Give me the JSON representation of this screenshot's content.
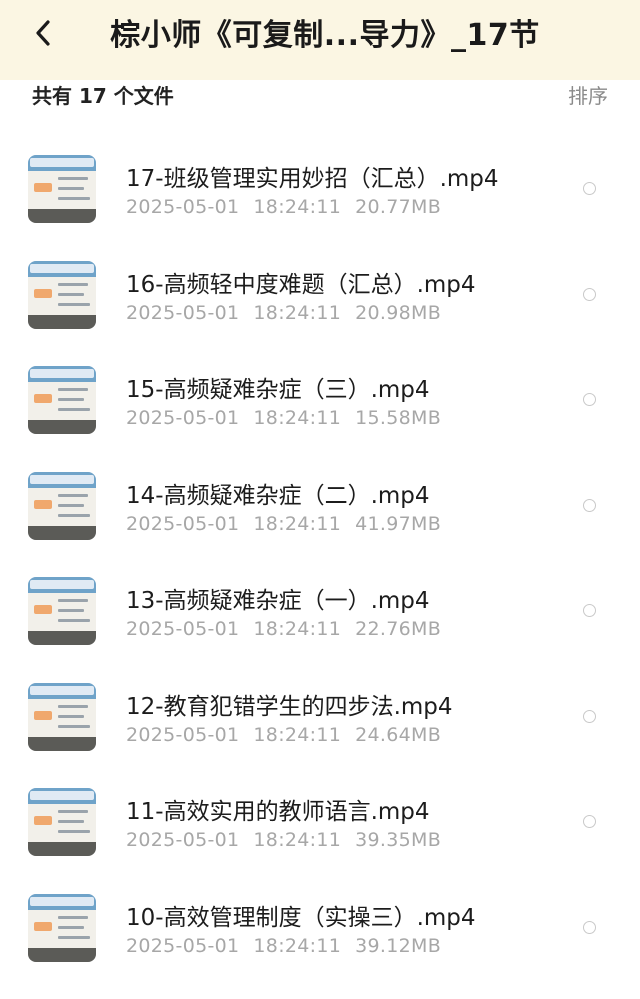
{
  "header": {
    "title": "棕小师《可复制...导力》_17节",
    "back_icon": "chevron-left-icon"
  },
  "toolbar": {
    "summary": "共有 17 个文件",
    "sort_label": "排序"
  },
  "files": [
    {
      "name": "17-班级管理实用妙招（汇总）.mp4",
      "date": "2025-05-01",
      "time": "18:24:11",
      "size": "20.77MB"
    },
    {
      "name": "16-高频轻中度难题（汇总）.mp4",
      "date": "2025-05-01",
      "time": "18:24:11",
      "size": "20.98MB"
    },
    {
      "name": "15-高频疑难杂症（三）.mp4",
      "date": "2025-05-01",
      "time": "18:24:11",
      "size": "15.58MB"
    },
    {
      "name": "14-高频疑难杂症（二）.mp4",
      "date": "2025-05-01",
      "time": "18:24:11",
      "size": "41.97MB"
    },
    {
      "name": "13-高频疑难杂症（一）.mp4",
      "date": "2025-05-01",
      "time": "18:24:11",
      "size": "22.76MB"
    },
    {
      "name": "12-教育犯错学生的四步法.mp4",
      "date": "2025-05-01",
      "time": "18:24:11",
      "size": "24.64MB"
    },
    {
      "name": "11-高效实用的教师语言.mp4",
      "date": "2025-05-01",
      "time": "18:24:11",
      "size": "39.35MB"
    },
    {
      "name": "10-高效管理制度（实操三）.mp4",
      "date": "2025-05-01",
      "time": "18:24:11",
      "size": "39.12MB"
    }
  ],
  "colors": {
    "header_bg": "#fbf6e3",
    "meta_text": "#a7a7a7",
    "radio_border": "#c9c9c9"
  }
}
